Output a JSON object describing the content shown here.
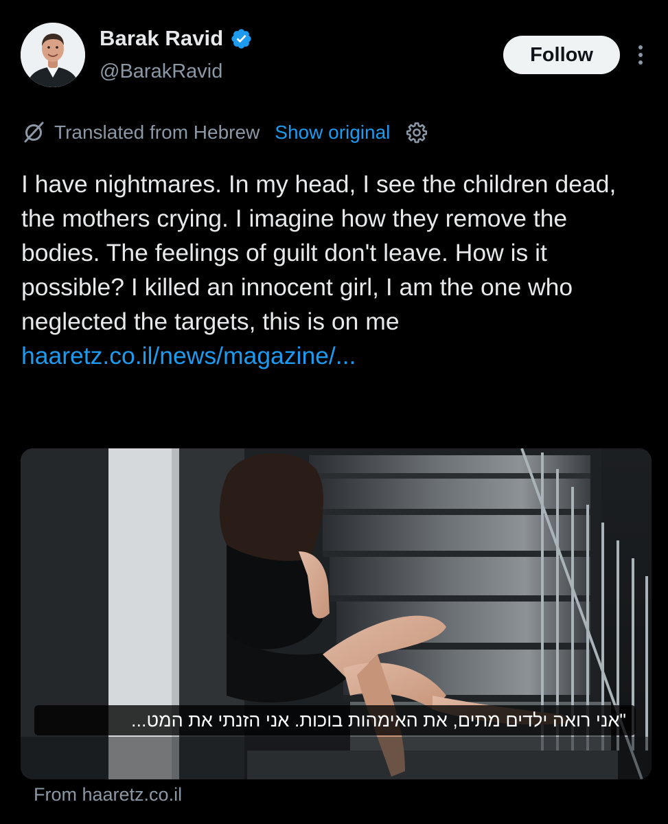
{
  "author": {
    "name": "Barak Ravid",
    "handle": "@BarakRavid",
    "verified": true,
    "avatar_icon": "profile-photo"
  },
  "header": {
    "follow_label": "Follow",
    "more_icon": "more-vertical-icon"
  },
  "translation": {
    "label": "Translated from Hebrew",
    "show_original_label": "Show original",
    "icon": "translate-slash-icon",
    "settings_icon": "gear-icon"
  },
  "tweet": {
    "text": "I have nightmares. In my head, I see the children dead, the mothers crying. I imagine how they remove the bodies. The feelings of guilt don't leave. How is it possible? I killed an innocent girl, I am the one who neglected the targets, this is on me",
    "link_text": "haaretz.co.il/news/magazine/..."
  },
  "card": {
    "caption": "\"אני רואה ילדים מתים, את האימהות בוכות. אני הזנתי את המט...",
    "source": "From haaretz.co.il"
  },
  "colors": {
    "background": "#000000",
    "text_primary": "#e7e9ea",
    "text_secondary": "#8b98a5",
    "link": "#1d9bf0",
    "verified": "#1d9bf0",
    "follow_bg": "#eff3f4"
  }
}
